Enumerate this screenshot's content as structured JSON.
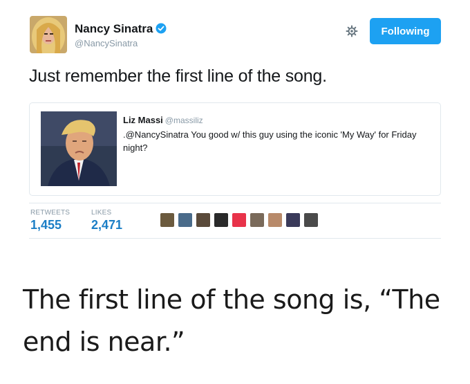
{
  "tweet": {
    "author_name": "Nancy Sinatra",
    "author_handle": "@NancySinatra",
    "follow_label": "Following",
    "text": "Just remember the first line of the song.",
    "colors": {
      "accent": "#1da1f2",
      "stat_value": "#1b7ec6",
      "muted": "#8899a6"
    }
  },
  "quoted_tweet": {
    "author_name": "Liz Massi",
    "author_handle": "@massiliz",
    "text": ".@NancySinatra You good w/ this guy using the iconic 'My Way' for Friday night?"
  },
  "stats": {
    "retweets_label": "RETWEETS",
    "retweets_value": "1,455",
    "likes_label": "LIKES",
    "likes_value": "2,471",
    "liker_avatar_colors": [
      "#6b5a3e",
      "#4a6b8a",
      "#5a4a3a",
      "#2a2a2a",
      "#e8334a",
      "#7a6a5a",
      "#b88a6a",
      "#3a3a5a",
      "#4a4a4a"
    ]
  },
  "caption": {
    "text": "The first line of the song is, “The end is near.”"
  },
  "icons": {
    "verified": "verified-badge-icon",
    "settings": "gear-icon"
  }
}
